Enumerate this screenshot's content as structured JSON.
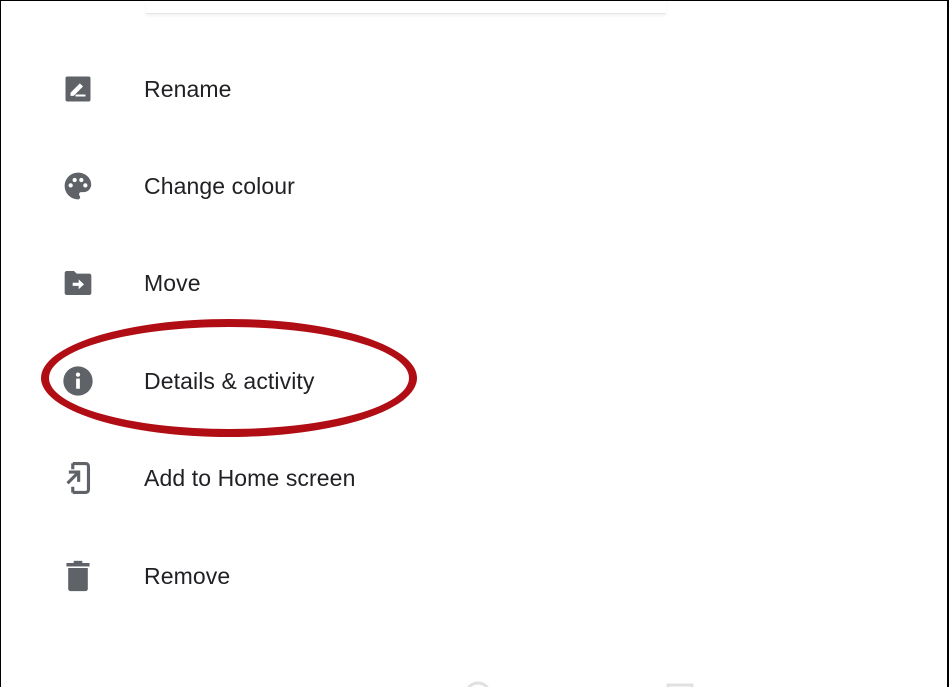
{
  "menu": {
    "items": [
      {
        "label": "Rename",
        "icon": "edit-icon"
      },
      {
        "label": "Change colour",
        "icon": "palette-icon"
      },
      {
        "label": "Move",
        "icon": "folder-move-icon"
      },
      {
        "label": "Details & activity",
        "icon": "info-icon"
      },
      {
        "label": "Add to Home screen",
        "icon": "add-to-home-icon"
      },
      {
        "label": "Remove",
        "icon": "trash-icon"
      }
    ]
  },
  "colors": {
    "icon": "#5f6368",
    "text": "#202124",
    "highlight": "#b00d14",
    "border": "#000000"
  }
}
